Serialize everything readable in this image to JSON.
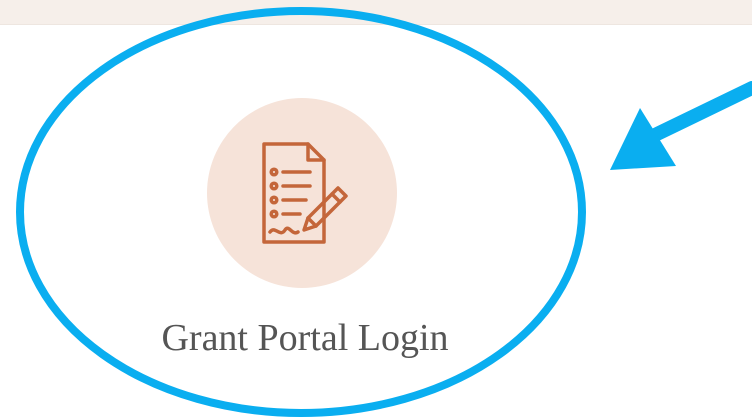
{
  "portal": {
    "label": "Grant Portal Login",
    "icon": "document-signature-icon"
  },
  "annotation": {
    "type": "circle-and-arrow",
    "color": "#0aaef0"
  },
  "colors": {
    "icon_background": "#f6e3d9",
    "icon_stroke": "#c4663a",
    "label_text": "#555555",
    "top_band": "#f6efea"
  }
}
